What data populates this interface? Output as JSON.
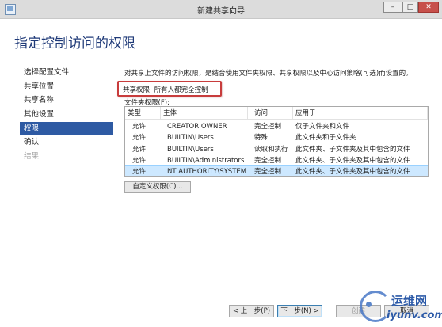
{
  "window": {
    "title": "新建共享向导",
    "minimize": "–",
    "maximize": "□",
    "close": "✕"
  },
  "page": {
    "title": "指定控制访问的权限"
  },
  "nav": {
    "items": [
      {
        "label": "选择配置文件",
        "state": "normal"
      },
      {
        "label": "共享位置",
        "state": "normal"
      },
      {
        "label": "共享名称",
        "state": "normal"
      },
      {
        "label": "其他设置",
        "state": "normal"
      },
      {
        "label": "权限",
        "state": "active"
      },
      {
        "label": "确认",
        "state": "normal"
      },
      {
        "label": "结果",
        "state": "disabled"
      }
    ]
  },
  "content": {
    "description": "对共享上文件的访问权限，是结合使用文件夹权限、共享权限以及中心访问策略(可选)而设置的。",
    "share_permission": "共享权限: 所有人都完全控制",
    "folder_permissions_label": "文件夹权限(F):",
    "custom_button": "自定义权限(C)..."
  },
  "table": {
    "headers": {
      "type": "类型",
      "principal": "主体",
      "access": "访问",
      "apply_to": "应用于"
    },
    "rows": [
      {
        "type": "允许",
        "principal": "CREATOR OWNER",
        "access": "完全控制",
        "apply_to": "仅子文件夹和文件",
        "selected": false
      },
      {
        "type": "允许",
        "principal": "BUILTIN\\Users",
        "access": "特殊",
        "apply_to": "此文件夹和子文件夹",
        "selected": false
      },
      {
        "type": "允许",
        "principal": "BUILTIN\\Users",
        "access": "读取和执行",
        "apply_to": "此文件夹、子文件夹及其中包含的文件",
        "selected": false
      },
      {
        "type": "允许",
        "principal": "BUILTIN\\Administrators",
        "access": "完全控制",
        "apply_to": "此文件夹、子文件夹及其中包含的文件",
        "selected": false
      },
      {
        "type": "允许",
        "principal": "NT AUTHORITY\\SYSTEM",
        "access": "完全控制",
        "apply_to": "此文件夹、子文件夹及其中包含的文件",
        "selected": true
      }
    ]
  },
  "footer": {
    "prev": "< 上一步(P)",
    "next": "下一步(N) >",
    "create": "创建",
    "cancel": "取消"
  },
  "watermark": {
    "main": "运维网",
    "sub": "iyunv.com"
  },
  "colors": {
    "accent": "#2e5aa3",
    "title_text": "#1f3a78",
    "highlight_border": "#c83c3c",
    "selected_row": "#cde8ff"
  }
}
